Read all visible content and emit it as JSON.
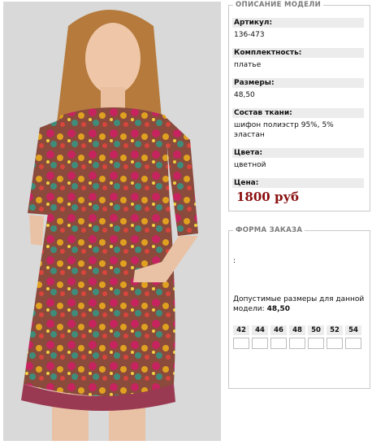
{
  "description": {
    "legend": "ОПИСАНИЕ МОДЕЛИ",
    "fields": [
      {
        "label": "Артикул:",
        "value": "136-473"
      },
      {
        "label": "Комплектность:",
        "value": "платье"
      },
      {
        "label": "Размеры:",
        "value": "48,50"
      },
      {
        "label": "Состав ткани:",
        "value": "шифон полиэстр 95%, 5% эластан"
      },
      {
        "label": "Цвета:",
        "value": "цветной"
      },
      {
        "label": "Цена:",
        "value": ""
      }
    ],
    "price": "1800 руб"
  },
  "order": {
    "legend": "ФОРМА ЗАКАЗА",
    "colon": ":",
    "allowed_text": "Допустимые размеры для данной модели:",
    "allowed_sizes": "48,50",
    "sizes": [
      "42",
      "44",
      "46",
      "48",
      "50",
      "52",
      "54"
    ]
  },
  "colors": {
    "price": "#8a0f0f",
    "label_bg": "#ececec",
    "border": "#c9c9c9",
    "photo_bg": "#d9d9d9"
  },
  "icons": [
    "product-photo"
  ]
}
